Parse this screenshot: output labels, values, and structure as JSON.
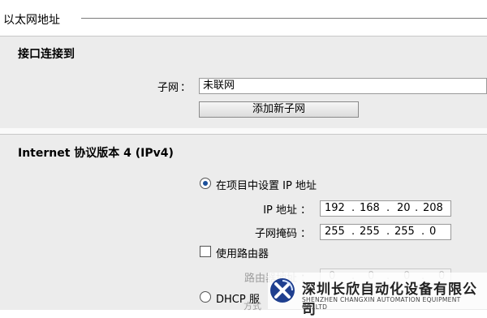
{
  "header": {
    "title": "以太网地址"
  },
  "interface_section": {
    "title": "接口连接到",
    "subnet_label": "子网",
    "colon": "：",
    "subnet_value": "未联网",
    "add_subnet_button": "添加新子网"
  },
  "ip_section": {
    "title": "Internet 协议版本 4 (IPv4)",
    "radio_set_in_project": "在项目中设置 IP 地址",
    "ip_label": "IP 地址",
    "ip_address": [
      "192",
      "168",
      "20",
      "208"
    ],
    "subnet_mask_label": "子网掩码",
    "subnet_mask": [
      "255",
      "255",
      "255",
      "0"
    ],
    "use_router_label": "使用路由器",
    "router_address_label": "路由器地址",
    "router_address": [
      "0",
      "0",
      "0",
      "0"
    ],
    "radio_dhcp": "DHCP 服",
    "dhcp_extra": "方式"
  },
  "watermark": {
    "company_cn": "深圳长欣自动化设备有限公司",
    "company_en": "SHENZHEN CHANGXIN AUTOMATION EQUIPMENT CO.,LTD"
  },
  "colors": {
    "accent": "#1a4f9a",
    "panel": "#ececec",
    "field_border": "#9a9a9a"
  }
}
